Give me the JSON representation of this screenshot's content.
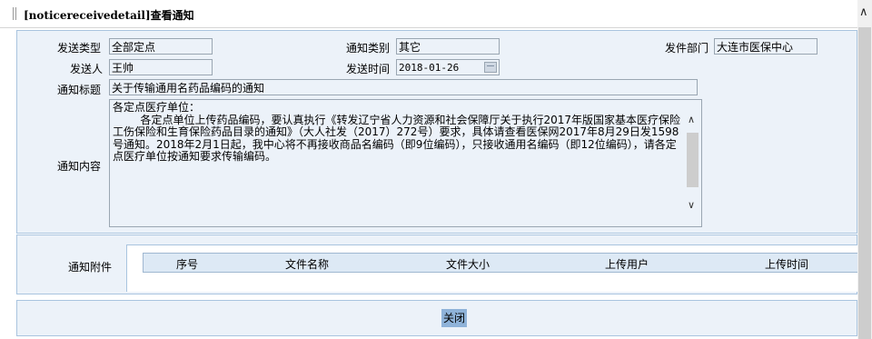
{
  "header": {
    "title": "[noticereceivedetail]查看通知"
  },
  "form": {
    "send_type": {
      "label": "发送类型",
      "value": "全部定点"
    },
    "notice_category": {
      "label": "通知类别",
      "value": "其它"
    },
    "send_dept": {
      "label": "发件部门",
      "value": "大连市医保中心"
    },
    "sender": {
      "label": "发送人",
      "value": "王帅"
    },
    "send_time": {
      "label": "发送时间",
      "value": "2018-01-26"
    },
    "notice_title": {
      "label": "通知标题",
      "value": "关于传输通用名药品编码的通知"
    },
    "notice_content": {
      "label": "通知内容",
      "value": "各定点医疗单位：\n        各定点单位上传药品编码，要认真执行《转发辽宁省人力资源和社会保障厅关于执行2017年版国家基本医疗保险工伤保险和生育保险药品目录的通知》（大人社发（2017）272号）要求，具体请查看医保网2017年8月29日发1598号通知。2018年2月1日起，我中心将不再接收商品名编码（即9位编码），只接收通用名编码（即12位编码），请各定点医疗单位按通知要求传输编码。"
    }
  },
  "attachments": {
    "label": "通知附件",
    "columns": [
      "序号",
      "文件名称",
      "文件大小",
      "上传用户",
      "上传时间"
    ],
    "rows": []
  },
  "footer": {
    "close_label": "关闭"
  },
  "colors": {
    "panel_bg": "#ecf2f9",
    "panel_border": "#a9c4df",
    "button_bg": "#8fb3d9"
  }
}
